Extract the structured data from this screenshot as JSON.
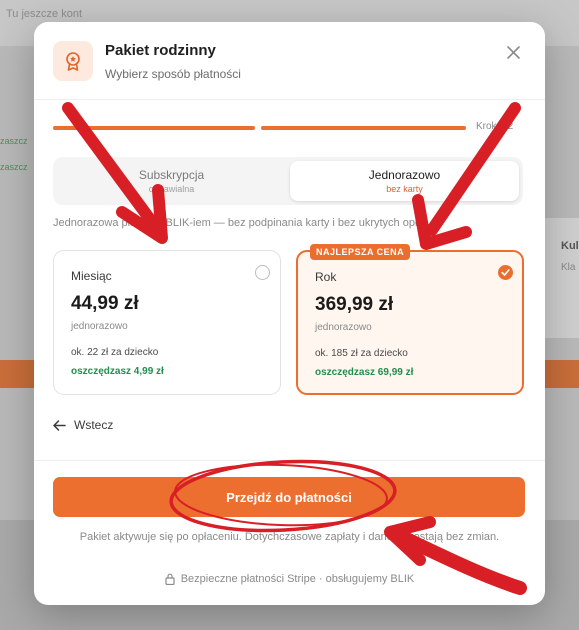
{
  "background": {
    "top_text": "Tu jeszcze kont",
    "side_texts": [
      "zaszcz",
      "zaszcz"
    ],
    "right_card_title": "Kul",
    "right_card_sub": "Kla"
  },
  "modal": {
    "title": "Pakiet rodzinny",
    "subtitle": "Wybierz sposób płatności",
    "close_icon": "close-icon",
    "header_icon": "badge-icon"
  },
  "stepper": {
    "label": "Krok 2/2",
    "progress": 1.0
  },
  "tabs": [
    {
      "label": "Subskrypcja",
      "sublabel": "odnawialna",
      "selected": false
    },
    {
      "label": "Jednorazowo",
      "sublabel": "bez karty",
      "selected": true
    }
  ],
  "info_text": "Jednorazowa płatność BLIK-iem — bez podpinania karty i bez ukrytych opłat.",
  "plans": [
    {
      "name": "Miesiąc",
      "price": "44,99 zł",
      "billing": "jednorazowo",
      "per_child": "ok. 22 zł za dziecko",
      "saving": "oszczędzasz 4,99 zł",
      "selected": false
    },
    {
      "name": "Rok",
      "price": "369,99 zł",
      "billing": "jednorazowo",
      "per_child": "ok. 185 zł za dziecko",
      "saving": "oszczędzasz 69,99 zł",
      "selected": true,
      "badge": "NAJLEPSZA CENA"
    }
  ],
  "back_label": "Wstecz",
  "cta_label": "Przejdź do płatności",
  "note": "Pakiet aktywuje się po opłaceniu. Dotychczasowe zapłaty i dane pozostają bez zmian.",
  "secure_text": "Bezpieczne płatności Stripe · obsługujemy BLIK",
  "colors": {
    "accent": "#ea6f2e",
    "success": "#1f8f4d",
    "annotation": "#d81f25"
  }
}
